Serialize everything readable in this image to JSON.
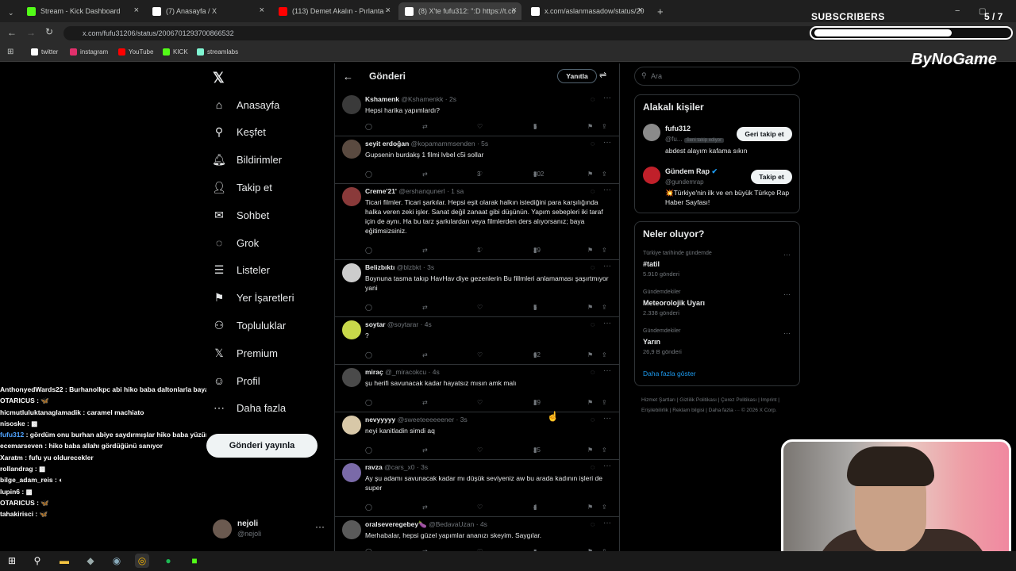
{
  "browser": {
    "tabs": [
      {
        "title": "Stream - Kick Dashboard",
        "color": "#53fc18"
      },
      {
        "title": "(7) Anasayfa / X",
        "color": "#ffffff"
      },
      {
        "title": "(113) Demet Akalın - Pırlanta -",
        "color": "#ff0000"
      },
      {
        "title": "(8) X'te fufu312: \":D https://t.co",
        "color": "#ffffff"
      },
      {
        "title": "x.com/aslanmasadow/status/20",
        "color": "#ffffff"
      }
    ],
    "url": "x.com/fufu31206/status/2006701293700866532",
    "bookmarks": [
      {
        "label": "twitter",
        "color": "#ffffff"
      },
      {
        "label": "instagram",
        "color": "#e1306c"
      },
      {
        "label": "YouTube",
        "color": "#ff0000"
      },
      {
        "label": "KICK",
        "color": "#53fc18"
      },
      {
        "label": "streamlabs",
        "color": "#80f5d2"
      }
    ]
  },
  "overlay": {
    "subscribers_label": "SUBSCRIBERS",
    "subscribers_count": "5 / 7",
    "subscribers_progress": 0.71,
    "brand": "ByNoGame"
  },
  "sidebar": {
    "items": [
      {
        "label": "Anasayfa",
        "icon": "home-icon"
      },
      {
        "label": "Keşfet",
        "icon": "search-icon"
      },
      {
        "label": "Bildirimler",
        "icon": "bell-icon"
      },
      {
        "label": "Takip et",
        "icon": "follow-icon"
      },
      {
        "label": "Sohbet",
        "icon": "mail-icon"
      },
      {
        "label": "Grok",
        "icon": "grok-icon"
      },
      {
        "label": "Listeler",
        "icon": "list-icon"
      },
      {
        "label": "Yer İşaretleri",
        "icon": "bookmark-icon"
      },
      {
        "label": "Topluluklar",
        "icon": "communities-icon"
      },
      {
        "label": "Premium",
        "icon": "x-icon"
      },
      {
        "label": "Profil",
        "icon": "profile-icon"
      },
      {
        "label": "Daha fazla",
        "icon": "more-icon"
      }
    ],
    "post_button": "Gönderi yayınla",
    "account": {
      "name": "nejoli",
      "handle": "@nejoli"
    }
  },
  "chat": [
    {
      "user": "AnthonyedWards22",
      "msg": "Burhanolkpc abi hiko baba daltonlarla baya fotosu var dikkat",
      "color": "#ffffff"
    },
    {
      "user": "OTARICUS",
      "msg": "🦋",
      "color": "#ffffff"
    },
    {
      "user": "hicmutluluktanaglamadik",
      "msg": "caramel machiato",
      "color": "#ffffff"
    },
    {
      "user": "nisoske",
      "msg": "▩",
      "color": "#ffffff"
    },
    {
      "user": "fufu312",
      "msg": "gördüm onu burhan abiye saydırmışlar hiko baba yüzünden",
      "color": "#4fa3ff"
    },
    {
      "user": "ecemarseven",
      "msg": "hiko baba allahı gördüğünü sanıyor",
      "color": "#ffffff"
    },
    {
      "user": "Xaratm",
      "msg": "fufu yu oldurecekler",
      "color": "#ffffff"
    },
    {
      "user": "rollandrag",
      "msg": "▩",
      "color": "#ffffff"
    },
    {
      "user": "bilge_adam_reis",
      "msg": "◐",
      "color": "#ffffff"
    },
    {
      "user": "lupin6",
      "msg": "▩",
      "color": "#ffffff"
    },
    {
      "user": "OTARICUS",
      "msg": "🦋",
      "color": "#ffffff"
    },
    {
      "user": "tahakirisci",
      "msg": "🦋",
      "color": "#ffffff"
    }
  ],
  "timeline": {
    "title": "Gönderi",
    "reply_button": "Yanıtla",
    "posts": [
      {
        "name": "Kshamenk",
        "handle": "@Kshamenkk",
        "time": "2s",
        "text": "Hepsi harika yapımlardı?",
        "likes": "",
        "views": "5",
        "av": "#3a3a3a"
      },
      {
        "name": "seyit erdoğan",
        "handle": "@kopamammsenden",
        "time": "5s",
        "text": "Gupsenin burdakş 1 filmi lvbel c5i sollar",
        "likes": "3",
        "views": "802",
        "av": "#5a4a40"
      },
      {
        "name": "Creme'21'",
        "handle": "@ershanqunerl",
        "time": "1 sa",
        "text": "Ticari filmler. Ticari şarkılar. Hepsi eşit olarak halkın istediğini para karşılığında halka veren zeki işler. Sanat değil zanaat gibi düşünün. Yapım sebepleri iki taraf için de aynı. Ha bu tarz şarkılardan veya filmlerden ders alıyorsanız; baya eğitimsizsiniz.",
        "likes": "1",
        "views": "29",
        "av": "#8a3a3a"
      },
      {
        "name": "Belizbıktı",
        "handle": "@blzbkt",
        "time": "3s",
        "text": "Boynuna tasma takıp HavHav diye gezenlerin  Bu fillmleri anlamaması şaşırtmıyor yani",
        "likes": "",
        "views": "5",
        "av": "#cccccc"
      },
      {
        "name": "soytar",
        "handle": "@soytarar",
        "time": "4s",
        "text": "?",
        "likes": "",
        "views": "62",
        "av": "#c8d84a"
      },
      {
        "name": "miraç",
        "handle": "@_miracokcu",
        "time": "4s",
        "text": "şu herifi savunacak kadar hayatsız mısın amk malı",
        "likes": "",
        "views": "29",
        "av": "#4a4a4a"
      },
      {
        "name": "nevyyyyy",
        "handle": "@sweeteeeeeener",
        "time": "3s",
        "text": "neyi kanitladin simdi aq",
        "likes": "",
        "views": "25",
        "av": "#d8c8a8"
      },
      {
        "name": "ravza",
        "handle": "@cars_x0",
        "time": "3s",
        "text": "Ay şu adamı savunacak kadar mı düşük seviyeniz aw bu arada kadının işleri de super",
        "likes": "",
        "views": "4",
        "av": "#7a6aa8"
      },
      {
        "name": "oralseveregebey🍆",
        "handle": "@BedavaUzan",
        "time": "4s",
        "text": "Merhabalar, hepsi güzel yapımlar ananızı skeyim. Saygılar.",
        "likes": "",
        "views": "",
        "av": "#5a5a5a"
      }
    ]
  },
  "right": {
    "search_placeholder": "Ara",
    "related_title": "Alakalı kişiler",
    "people": [
      {
        "name": "fufu312",
        "handle": "@fu...",
        "badge": "Seni takip ediyor",
        "bio": "abdest alayım kafama sıkın",
        "button": "Geri takip et",
        "av": "#8a8a8a"
      },
      {
        "name": "Gündem Rap",
        "handle": "@gundemrap",
        "badge": "",
        "bio": "💥Türkiye'nin ilk ve en büyük Türkçe Rap Haber Sayfası!",
        "button": "Takip et",
        "av": "#c0202a"
      }
    ],
    "trends_title": "Neler oluyor?",
    "trends": [
      {
        "context": "Türkiye tarihinde gündemde",
        "name": "#tatil",
        "count": "5.910 gönderi"
      },
      {
        "context": "Gündemdekiler",
        "name": "Meteorolojik Uyarı",
        "count": "2.338 gönderi"
      },
      {
        "context": "Gündemdekiler",
        "name": "Yarın",
        "count": "26,9 B gönderi"
      }
    ],
    "show_more": "Daha fazla göster",
    "footer": "Hizmet Şartları  |  Gizlilik Politikası  |  Çerez Politikası  |  Imprint  |  Erişilebilirlik  |  Reklam bilgisi  |  Daha fazla ···  © 2026 X Corp."
  }
}
